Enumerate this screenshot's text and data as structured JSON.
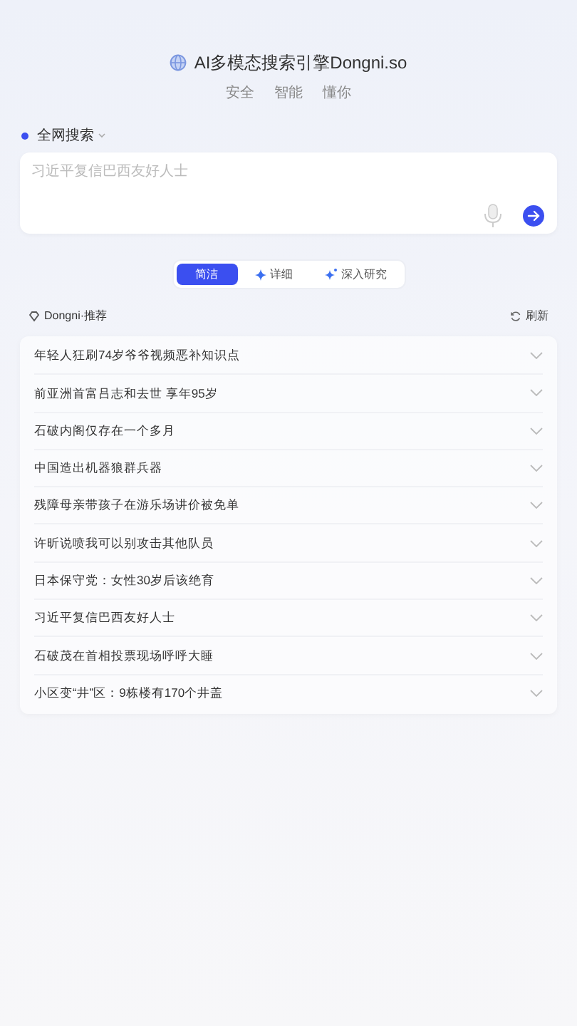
{
  "header": {
    "title": "AI多模态搜索引擎Dongni.so",
    "taglines": [
      "安全",
      "智能",
      "懂你"
    ]
  },
  "search": {
    "scope": "全网搜索",
    "placeholder": "习近平复信巴西友好人士"
  },
  "modes": [
    {
      "label": "简洁",
      "selected": true,
      "kind": "plain"
    },
    {
      "label": "详细",
      "selected": false,
      "kind": "spark"
    },
    {
      "label": "深入研究",
      "selected": false,
      "kind": "sparks"
    }
  ],
  "recommend": {
    "title": "Dongni·推荐",
    "refresh": "刷新"
  },
  "topics": [
    "年轻人狂刷74岁爷爷视频恶补知识点",
    "前亚洲首富吕志和去世 享年95岁",
    "石破内阁仅存在一个多月",
    "中国造出机器狼群兵器",
    "残障母亲带孩子在游乐场讲价被免单",
    "许昕说喷我可以别攻击其他队员",
    "日本保守党：女性30岁后该绝育",
    "习近平复信巴西友好人士",
    "石破茂在首相投票现场呼呼大睡",
    "小区变“井”区：9栋楼有170个井盖"
  ]
}
